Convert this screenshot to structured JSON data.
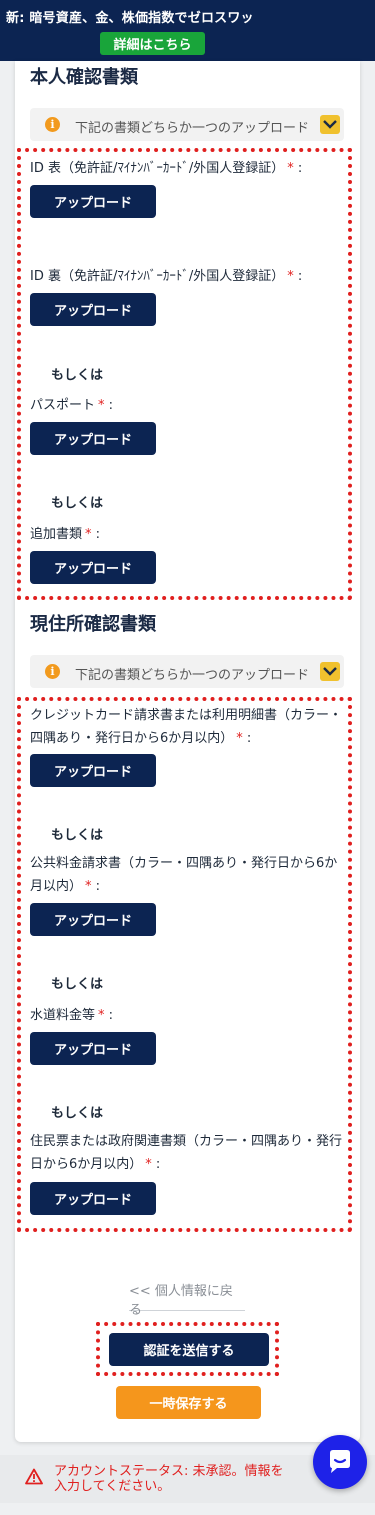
{
  "banner": {
    "prefix": "新:",
    "text": "暗号資産、金、株価指数でゼロスワッ",
    "details_label": "詳細はこちら"
  },
  "identity": {
    "title": "本人確認書類",
    "info_text": "下記の書類どちらか一つのアップロード",
    "id_front_label": "ID 表（免許証/ﾏｲﾅﾝﾊﾞｰｶｰﾄﾞ/外国人登録証）",
    "id_back_label": "ID 裏（免許証/ﾏｲﾅﾝﾊﾞｰｶｰﾄﾞ/外国人登録証）",
    "passport_label": "パスポート",
    "additional_label": "追加書類"
  },
  "address": {
    "title": "現住所確認書類",
    "info_text": "下記の書類どちらか一つのアップロード",
    "credit_label": "クレジットカード請求書または利用明細書（カラー・四隅あり・発行日から6か月以内）",
    "utility_label": "公共料金請求書（カラー・四隅あり・発行日から6か月以内）",
    "water_label": "水道料金等",
    "resident_label": "住民票または政府関連書類（カラー・四隅あり・発行日から6か月以内）"
  },
  "common": {
    "upload_label": "アップロード",
    "or_label": "もしくは",
    "required_mark": "*",
    "colon": ":"
  },
  "actions": {
    "back_label": "<< 個人情報に戻る",
    "send_label": "認証を送信する",
    "save_label": "一時保存する"
  },
  "status": {
    "text": "アカウントステータス: 未承認。情報を入力してください。"
  },
  "colors": {
    "navy": "#0c2452",
    "orange": "#f5961c",
    "red": "#e0201f",
    "green": "#19a53a",
    "chat_blue": "#1e22e8"
  },
  "icons": [
    "info-icon",
    "chevron-down-icon",
    "warning-icon",
    "chat-icon"
  ]
}
